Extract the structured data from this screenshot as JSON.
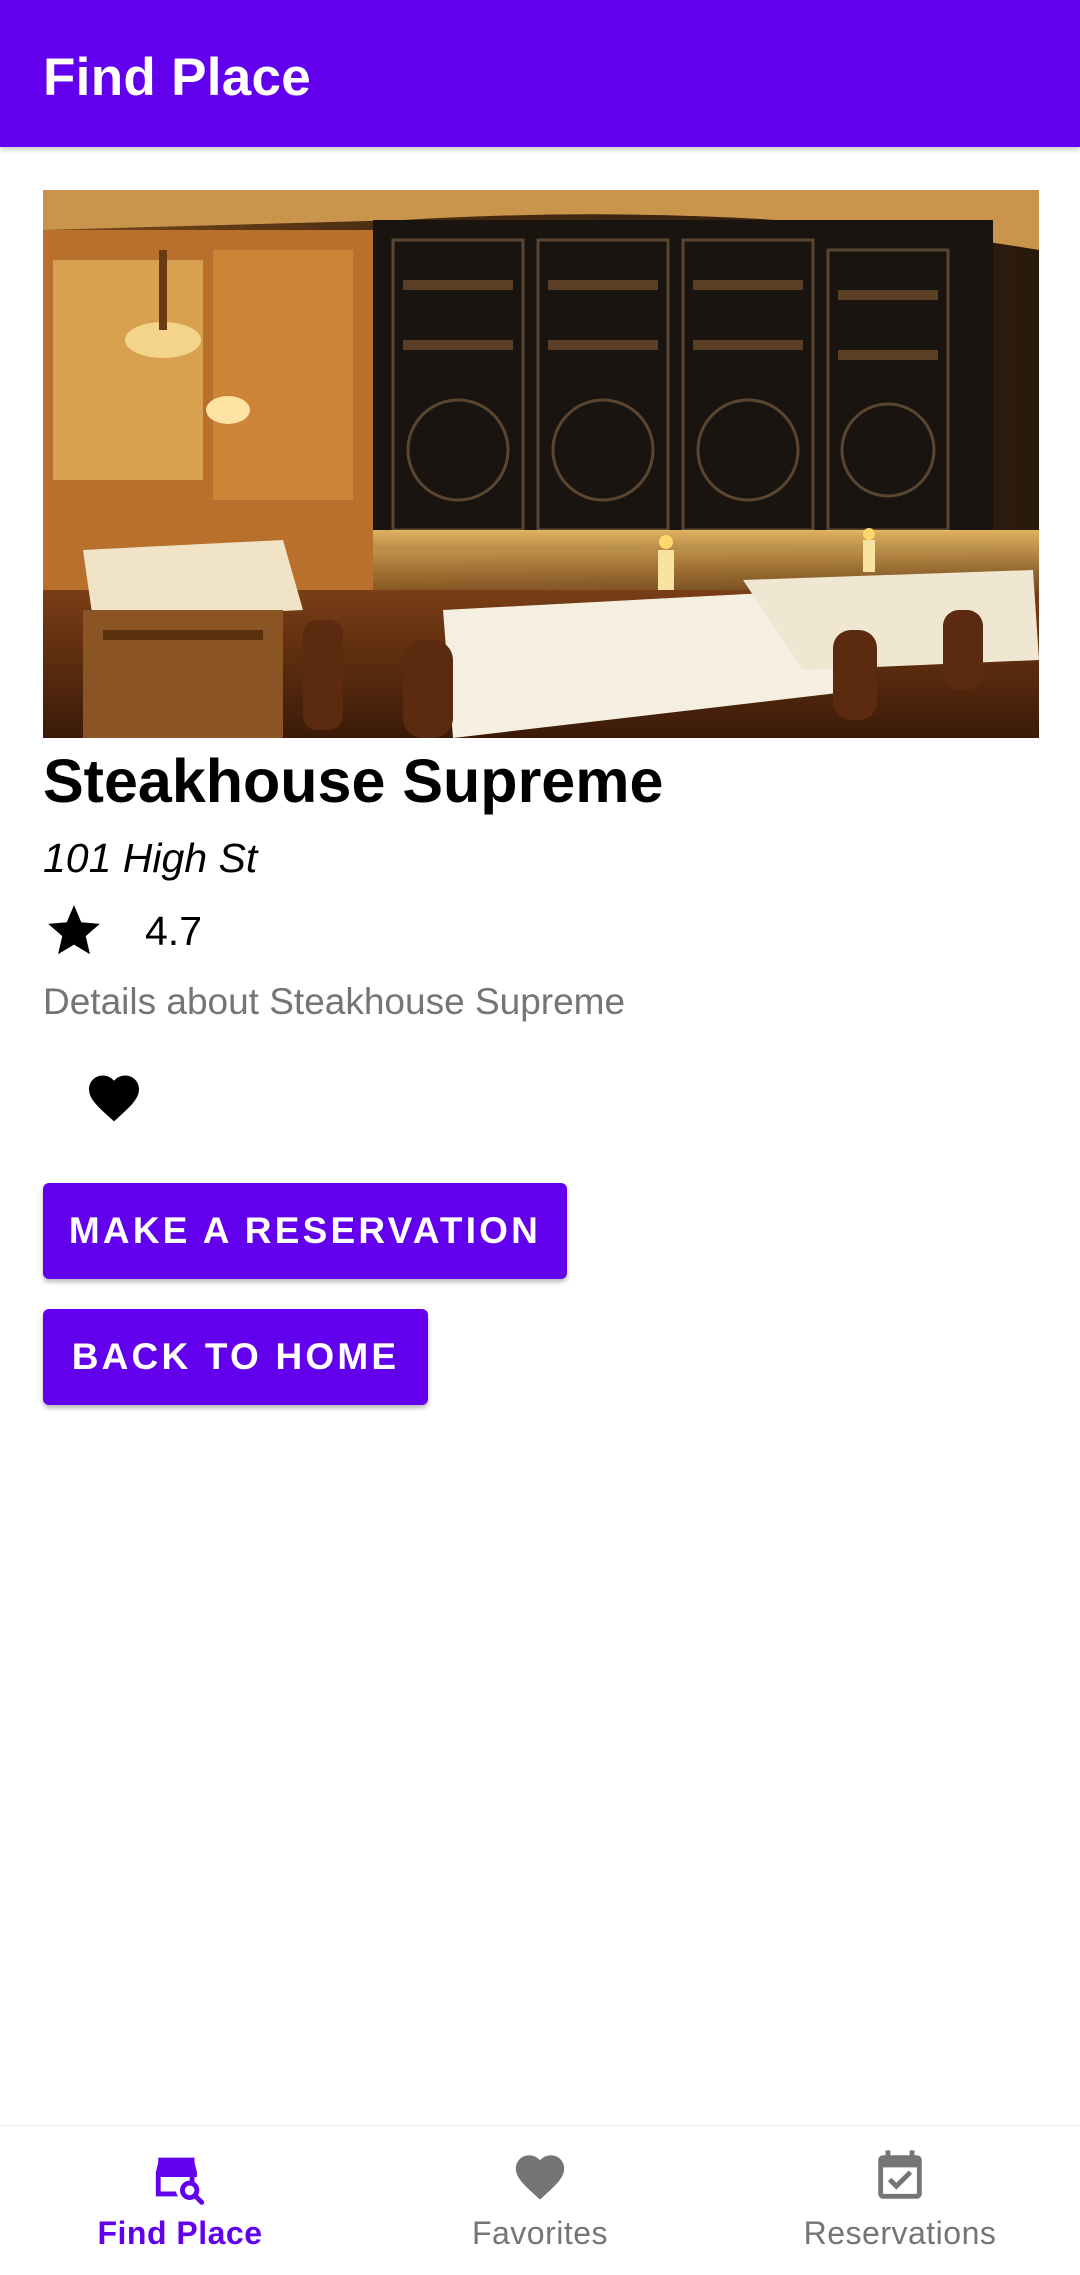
{
  "app_bar": {
    "title": "Find Place"
  },
  "place": {
    "name": "Steakhouse Supreme",
    "address": "101 High St",
    "rating": "4.7",
    "details": "Details about Steakhouse Supreme",
    "is_favorite": true
  },
  "actions": {
    "reserve_label": "MAKE A RESERVATION",
    "home_label": "BACK TO HOME"
  },
  "icons": {
    "rating": "star-icon",
    "favorite": "heart-icon",
    "nav_find": "store-search-icon",
    "nav_favorites": "heart-icon",
    "nav_reservations": "calendar-check-icon"
  },
  "bottom_nav": {
    "active": "find_place",
    "items": [
      {
        "id": "find_place",
        "label": "Find Place"
      },
      {
        "id": "favorites",
        "label": "Favorites"
      },
      {
        "id": "reservations",
        "label": "Reservations"
      }
    ]
  },
  "colors": {
    "primary": "#6200ee",
    "on_primary": "#ffffff",
    "secondary_text": "#757575",
    "inactive_nav": "#757575"
  }
}
